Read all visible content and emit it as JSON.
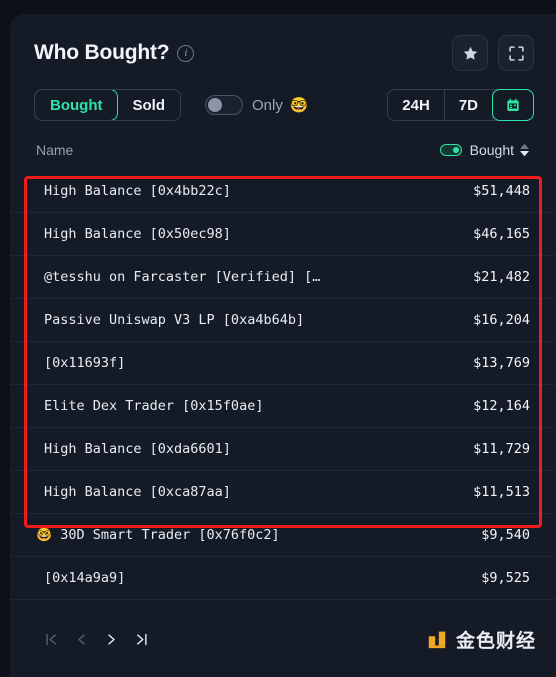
{
  "header": {
    "title": "Who Bought?",
    "info_icon": "info-icon",
    "favorite_icon": "star-icon",
    "expand_icon": "expand-icon"
  },
  "filters": {
    "segments": [
      {
        "label": "Bought",
        "active": true
      },
      {
        "label": "Sold",
        "active": false
      }
    ],
    "only_toggle": {
      "label": "Only",
      "emoji": "🤓",
      "state": "off"
    },
    "time_ranges": [
      {
        "label": "24H",
        "active": false
      },
      {
        "label": "7D",
        "active": false
      },
      {
        "label": "",
        "icon": "calendar-icon",
        "active": true
      }
    ]
  },
  "table": {
    "columns": {
      "name": "Name",
      "value": "Bought"
    },
    "sort": {
      "column": "Bought",
      "direction": "desc"
    },
    "value_toggle_state": "on",
    "rows": [
      {
        "emoji": "",
        "name": "High Balance [0x4bb22c]",
        "value": "$51,448"
      },
      {
        "emoji": "",
        "name": "High Balance [0x50ec98]",
        "value": "$46,165"
      },
      {
        "emoji": "",
        "name": "@tesshu on Farcaster [Verified] […",
        "value": "$21,482"
      },
      {
        "emoji": "",
        "name": "Passive Uniswap V3 LP [0xa4b64b]",
        "value": "$16,204"
      },
      {
        "emoji": "",
        "name": "[0x11693f]",
        "value": "$13,769"
      },
      {
        "emoji": "",
        "name": "Elite Dex Trader [0x15f0ae]",
        "value": "$12,164"
      },
      {
        "emoji": "",
        "name": "High Balance [0xda6601]",
        "value": "$11,729"
      },
      {
        "emoji": "",
        "name": "High Balance [0xca87aa]",
        "value": "$11,513"
      },
      {
        "emoji": "🤓",
        "name": "30D Smart Trader [0x76f0c2]",
        "value": "$9,540"
      },
      {
        "emoji": "",
        "name": "[0x14a9a9]",
        "value": "$9,525"
      }
    ]
  },
  "pagination": {
    "first": "first-page",
    "prev": "prev-page",
    "next": "next-page",
    "last": "last-page"
  },
  "watermark": {
    "text": "金色财经"
  },
  "colors": {
    "accent_green": "#2de3a5",
    "annotation_red": "#f01b1b",
    "card_bg": "#141b26",
    "page_bg": "#0c1118",
    "logo_orange": "#f0a826"
  }
}
